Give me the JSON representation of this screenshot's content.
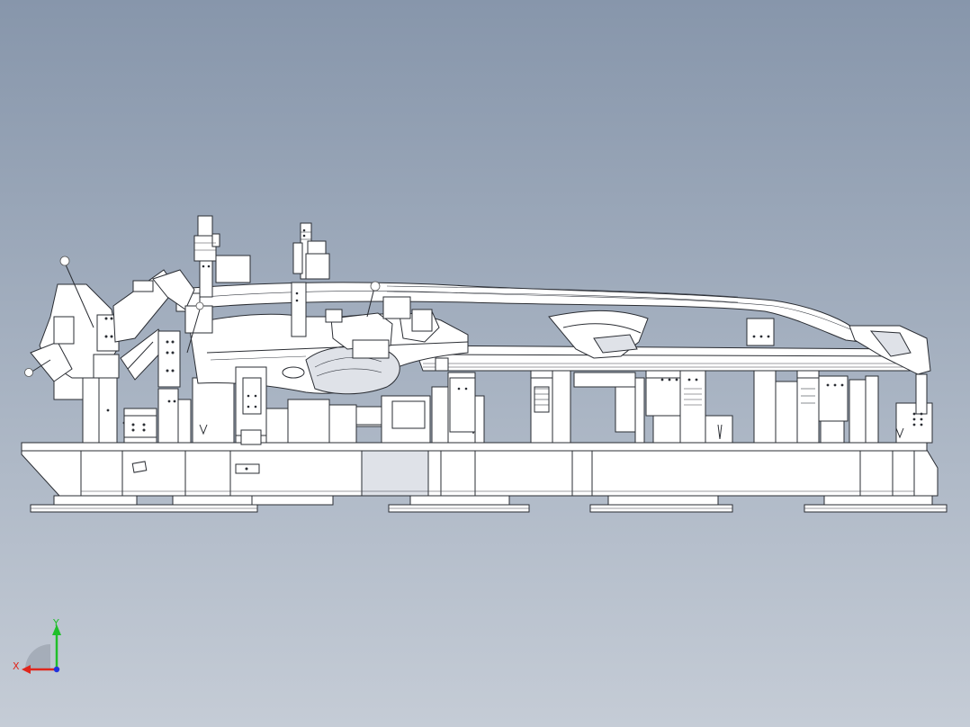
{
  "viewport": {
    "background_top": "#8796ab",
    "background_bottom": "#c5ccd6",
    "model": "welding-fixture-side-view"
  },
  "triad": {
    "x_label": "X",
    "y_label": "Y",
    "x_color": "#e0261c",
    "y_color": "#1fbf2a",
    "z_color": "#2233dd"
  }
}
